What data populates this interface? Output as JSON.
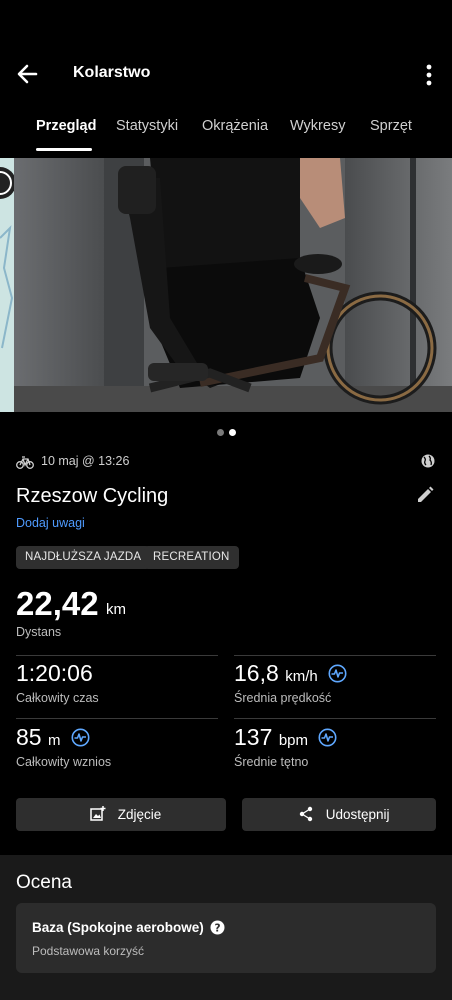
{
  "header": {
    "title": "Kolarstwo"
  },
  "tabs": [
    {
      "label": "Przegląd",
      "active": true
    },
    {
      "label": "Statystyki"
    },
    {
      "label": "Okrążenia"
    },
    {
      "label": "Wykresy"
    },
    {
      "label": "Sprzęt"
    }
  ],
  "photo": {
    "pages": 2,
    "current_page": 2
  },
  "activity": {
    "date": "10 maj @ 13:26",
    "name": "Rzeszow Cycling",
    "add_notes": "Dodaj uwagi",
    "badges": [
      "NAJDŁUŻSZA JAZDA",
      "RECREATION"
    ]
  },
  "distance": {
    "value": "22,42",
    "unit": "km",
    "label": "Dystans"
  },
  "stats": [
    {
      "value": "1:20:06",
      "unit": "",
      "label": "Całkowity czas"
    },
    {
      "value": "16,8",
      "unit": "km/h",
      "label": "Średnia prędkość"
    },
    {
      "value": "85",
      "unit": "m",
      "label": "Całkowity wznios"
    },
    {
      "value": "137",
      "unit": "bpm",
      "label": "Średnie tętno"
    }
  ],
  "buttons": {
    "photo": "Zdjęcie",
    "share": "Udostępnij"
  },
  "assessment": {
    "title": "Ocena",
    "card_title": "Baza (Spokojne aerobowe)",
    "card_sub": "Podstawowa korzyść"
  },
  "colors": {
    "accent_link": "#4f9bff",
    "background": "#000000",
    "card": "#2c2c2c"
  }
}
